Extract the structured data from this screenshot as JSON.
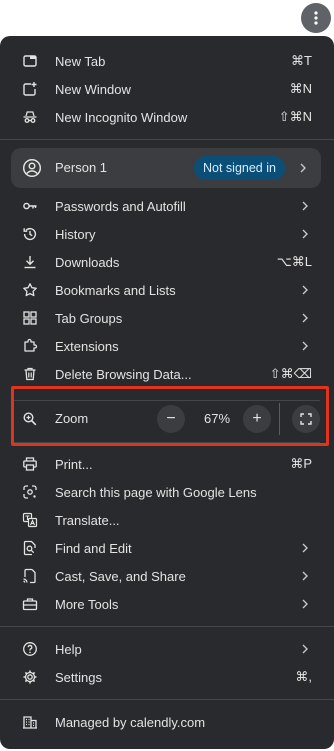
{
  "colors": {
    "menu_bg": "#292a2d",
    "hover_bg": "#3c3d40",
    "badge_bg": "#0b4f78",
    "highlight_border": "#e0341e",
    "text": "#e3e3e3"
  },
  "top": {
    "menu_button_icon": "vertical-dots-icon"
  },
  "section1": [
    {
      "label": "New Tab",
      "shortcut": "⌘T",
      "icon": "new-tab-icon"
    },
    {
      "label": "New Window",
      "shortcut": "⌘N",
      "icon": "new-window-icon"
    },
    {
      "label": "New Incognito Window",
      "shortcut": "⇧⌘N",
      "icon": "incognito-icon"
    }
  ],
  "profile": {
    "name": "Person 1",
    "status": "Not signed in",
    "icon": "account-circle-icon"
  },
  "section2": [
    {
      "label": "Passwords and Autofill",
      "shortcut": "",
      "icon": "key-icon",
      "submenu": true
    },
    {
      "label": "History",
      "shortcut": "",
      "icon": "history-icon",
      "submenu": true
    },
    {
      "label": "Downloads",
      "shortcut": "⌥⌘L",
      "icon": "download-icon",
      "submenu": false
    },
    {
      "label": "Bookmarks and Lists",
      "shortcut": "",
      "icon": "star-icon",
      "submenu": true
    },
    {
      "label": "Tab Groups",
      "shortcut": "",
      "icon": "tab-groups-icon",
      "submenu": true
    },
    {
      "label": "Extensions",
      "shortcut": "",
      "icon": "extension-icon",
      "submenu": true
    },
    {
      "label": "Delete Browsing Data...",
      "shortcut": "⇧⌘⌫",
      "icon": "trash-icon",
      "submenu": false
    }
  ],
  "zoom": {
    "label": "Zoom",
    "value": "67%",
    "minus": "−",
    "plus": "+",
    "icon": "zoom-icon"
  },
  "section3": [
    {
      "label": "Print...",
      "shortcut": "⌘P",
      "icon": "print-icon",
      "submenu": false
    },
    {
      "label": "Search this page with Google Lens",
      "shortcut": "",
      "icon": "lens-icon",
      "submenu": false
    },
    {
      "label": "Translate...",
      "shortcut": "",
      "icon": "translate-icon",
      "submenu": false
    },
    {
      "label": "Find and Edit",
      "shortcut": "",
      "icon": "find-icon",
      "submenu": true
    },
    {
      "label": "Cast, Save, and Share",
      "shortcut": "",
      "icon": "cast-icon",
      "submenu": true
    },
    {
      "label": "More Tools",
      "shortcut": "",
      "icon": "toolbox-icon",
      "submenu": true
    }
  ],
  "section4": [
    {
      "label": "Help",
      "shortcut": "",
      "icon": "help-icon",
      "submenu": true
    },
    {
      "label": "Settings",
      "shortcut": "⌘,",
      "icon": "settings-icon",
      "submenu": false
    }
  ],
  "footer": {
    "label": "Managed by calendly.com",
    "icon": "managed-building-icon"
  }
}
